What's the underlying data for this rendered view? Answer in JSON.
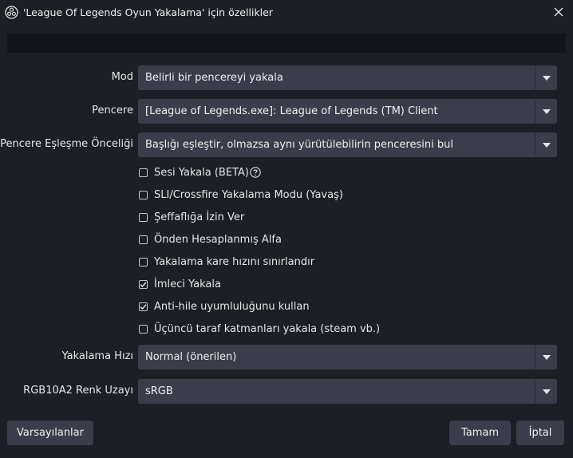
{
  "window": {
    "title": "'League Of Legends Oyun Yakalama' için özellikler"
  },
  "form": {
    "mode": {
      "label": "Mod",
      "value": "Belirli bir pencereyi yakala"
    },
    "window_select": {
      "label": "Pencere",
      "value": "[League of Legends.exe]: League of Legends (TM) Client"
    },
    "match_priority": {
      "label": "Pencere Eşleşme Önceliği",
      "value": "Başlığı eşleştir, olmazsa aynı yürütülebilirin penceresini bul"
    },
    "checkboxes": [
      {
        "label": "Sesi Yakala (BETA)",
        "checked": false,
        "help": true
      },
      {
        "label": "SLI/Crossfire Yakalama Modu (Yavaş)",
        "checked": false
      },
      {
        "label": "Şeffaflığa İzin Ver",
        "checked": false
      },
      {
        "label": "Önden Hesaplanmış Alfa",
        "checked": false
      },
      {
        "label": "Yakalama kare hızını sınırlandır",
        "checked": false
      },
      {
        "label": "İmleci Yakala",
        "checked": true
      },
      {
        "label": "Anti-hile uyumluluğunu kullan",
        "checked": true
      },
      {
        "label": "Üçüncü taraf katmanları yakala (steam vb.)",
        "checked": false
      }
    ],
    "capture_rate": {
      "label": "Yakalama Hızı",
      "value": "Normal (önerilen)"
    },
    "color_space": {
      "label": "RGB10A2 Renk Uzayı",
      "value": "sRGB"
    }
  },
  "buttons": {
    "defaults": "Varsayılanlar",
    "ok": "Tamam",
    "cancel": "İptal"
  },
  "colors": {
    "background": "#1d1f26",
    "control": "#3b3e4a",
    "preview": "#15161b"
  }
}
